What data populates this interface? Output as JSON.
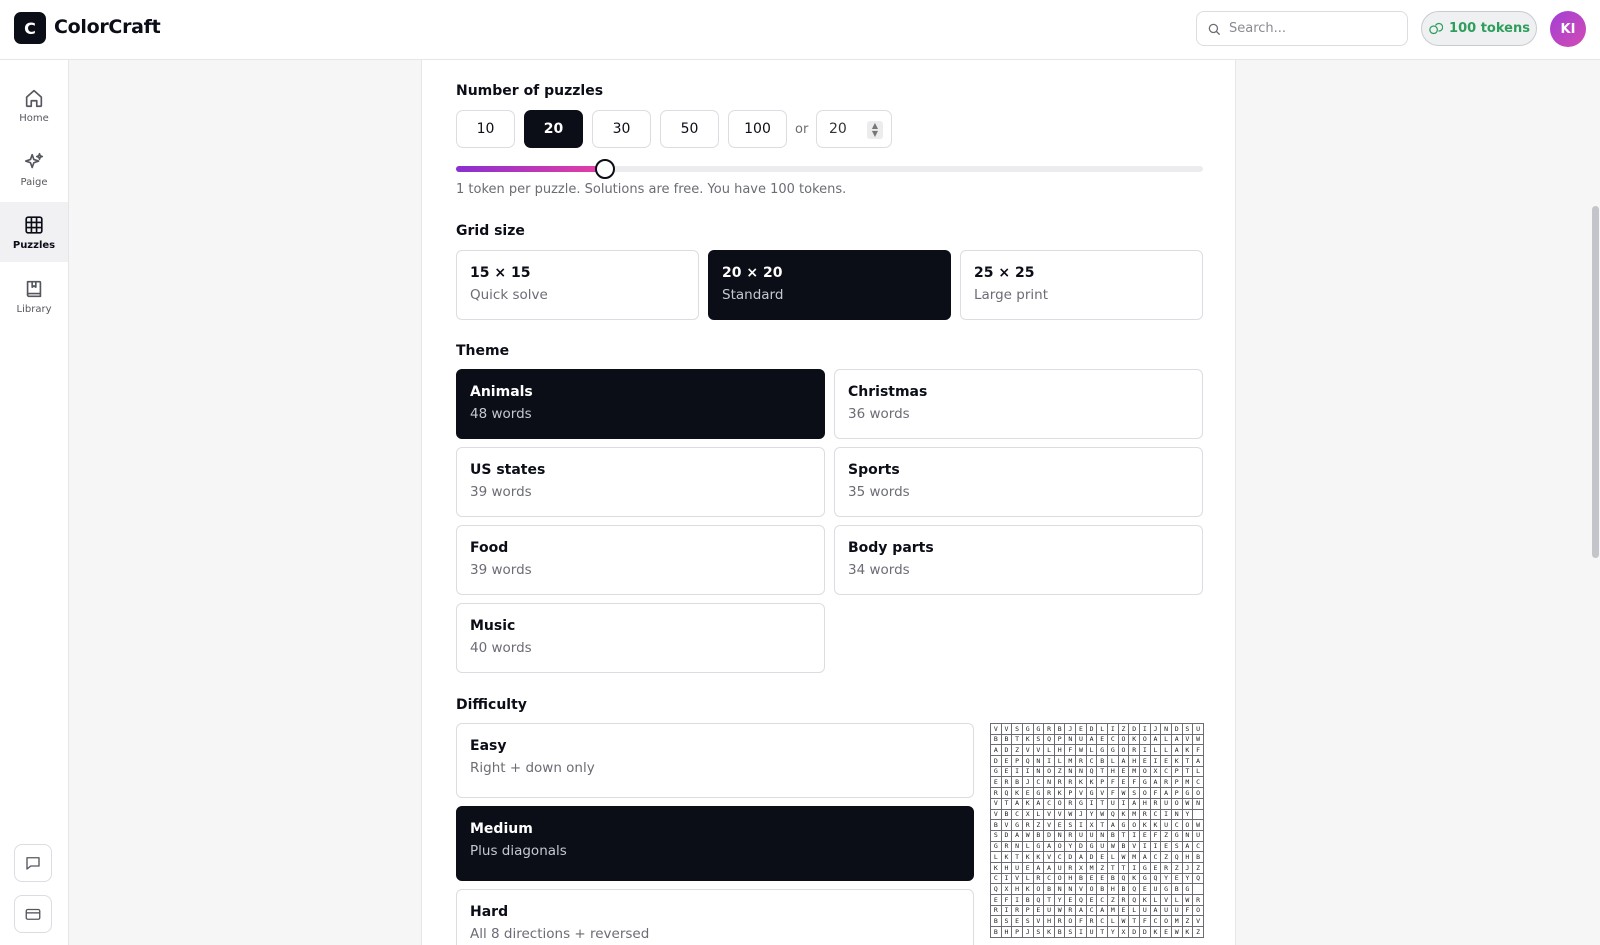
{
  "app": {
    "logo_letter": "C",
    "name": "ColorCraft"
  },
  "header": {
    "search_placeholder": "Search...",
    "tokens_label": "100 tokens",
    "avatar_initials": "KI"
  },
  "sidebar": {
    "items": [
      {
        "label": "Home",
        "icon": "home-icon",
        "active": false
      },
      {
        "label": "Paige",
        "icon": "sparkles-icon",
        "active": false
      },
      {
        "label": "Puzzles",
        "icon": "grid-icon",
        "active": true
      },
      {
        "label": "Library",
        "icon": "book-icon",
        "active": false
      }
    ],
    "bottom_buttons": [
      "chat-icon",
      "credit-card-icon"
    ]
  },
  "puzzle_count": {
    "label": "Number of puzzles",
    "options": [
      "10",
      "20",
      "30",
      "50",
      "100"
    ],
    "selected": "20",
    "or_label": "or",
    "custom_value": "20",
    "slider_fraction": 0.2,
    "hint": "1 token per puzzle. Solutions are free. You have 100 tokens."
  },
  "grid_size": {
    "label": "Grid size",
    "options": [
      {
        "title": "15 × 15",
        "subtitle": "Quick solve",
        "selected": false
      },
      {
        "title": "20 × 20",
        "subtitle": "Standard",
        "selected": true
      },
      {
        "title": "25 × 25",
        "subtitle": "Large print",
        "selected": false
      }
    ]
  },
  "theme": {
    "label": "Theme",
    "options": [
      {
        "title": "Animals",
        "subtitle": "48 words",
        "selected": true
      },
      {
        "title": "Christmas",
        "subtitle": "36 words",
        "selected": false
      },
      {
        "title": "US states",
        "subtitle": "39 words",
        "selected": false
      },
      {
        "title": "Sports",
        "subtitle": "35 words",
        "selected": false
      },
      {
        "title": "Food",
        "subtitle": "39 words",
        "selected": false
      },
      {
        "title": "Body parts",
        "subtitle": "34 words",
        "selected": false
      },
      {
        "title": "Music",
        "subtitle": "40 words",
        "selected": false
      }
    ]
  },
  "difficulty": {
    "label": "Difficulty",
    "options": [
      {
        "title": "Easy",
        "subtitle": "Right + down only",
        "selected": false
      },
      {
        "title": "Medium",
        "subtitle": "Plus diagonals",
        "selected": true
      },
      {
        "title": "Hard",
        "subtitle": "All 8 directions + reversed",
        "selected": false
      }
    ]
  },
  "preview_grid": [
    "VVSGGRBJEDLIZDIJNDSU",
    "BBTKSQPNUAECOKOALAVW",
    "ADZVVLHFWLGGORILLAKF",
    "DEPQNILMRCBLAHEIEKTA",
    "GEIINOZNNQTHEMOXCPTL",
    "ERBJCNRRKKPFEFGARPMC",
    "RQKEGRKPVGVFWSOFAPGO",
    "VTAKACORGITUIAHRUOWN",
    "VBCXLVVWJYWQKMRCINY",
    "BVGRZVESIXTAGOKKUCOW",
    "SDAWBDNRUUNBTIEFZGNU",
    "GRNLGAOYDGUWBVIIESAC",
    "LKTKKVCDADELWMACZQHB",
    "KHUEAAURXMZTTIGERZJZ",
    "CIVLRCOHBEEBQKGQYEYQ",
    "QXHKOBNNVOBHBQEUGBG",
    "EFIBQTYEQECZRQKLVLWR",
    "RIRPEUWRACAMELUAUUFO",
    "BSESVHROFRCLWTFCOMZV",
    "BHPJSKBSIUTYXDDKEWKZ"
  ]
}
